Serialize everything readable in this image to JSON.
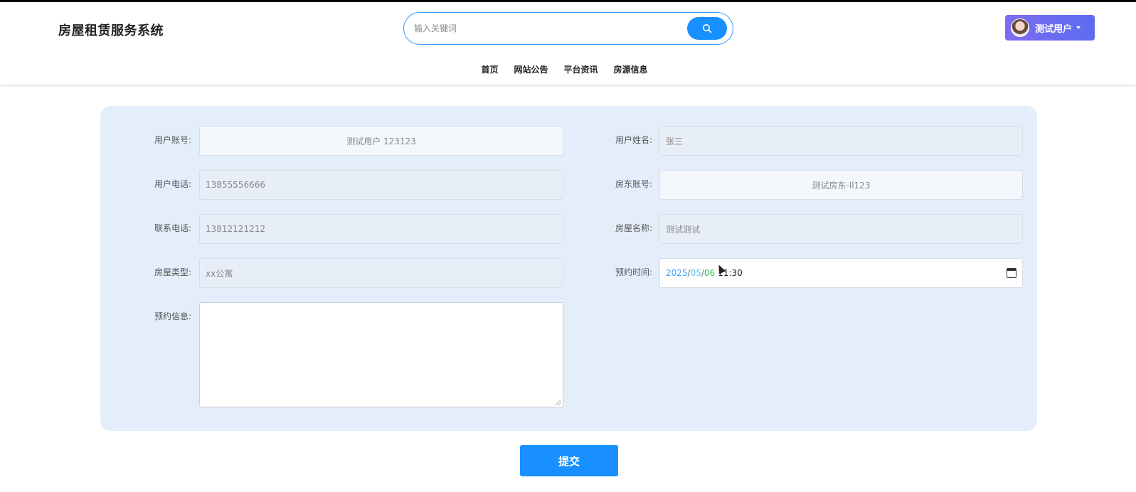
{
  "header": {
    "site_title": "房屋租赁服务系统",
    "search_placeholder": "输入关键词",
    "user_name": "测试用户"
  },
  "nav": {
    "items": [
      "首页",
      "网站公告",
      "平台资讯",
      "房源信息"
    ]
  },
  "form": {
    "user_account_label": "用户账号:",
    "user_account_value": "测试用户 123123",
    "user_name_label": "用户姓名:",
    "user_name_value": "张三",
    "user_phone_label": "用户电话:",
    "user_phone_value": "13855556666",
    "landlord_account_label": "房东账号:",
    "landlord_account_value": "测试房东-ll123",
    "contact_phone_label": "联系电话:",
    "contact_phone_value": "13812121212",
    "house_name_label": "房屋名称:",
    "house_name_value": "测试测试",
    "house_type_label": "房屋类型:",
    "house_type_value": "xx公寓",
    "appointment_time_label": "预约时间:",
    "appointment_date": {
      "year": "2025",
      "month": "05",
      "day": "06",
      "time": "11:30"
    },
    "appointment_info_label": "预约信息:"
  },
  "submit_label": "提交",
  "colors": {
    "primary": "#1890ff",
    "panel_bg": "#e4eefb",
    "user_button_gradient_start": "#7d6cf0",
    "user_button_gradient_end": "#5b6cf2"
  }
}
